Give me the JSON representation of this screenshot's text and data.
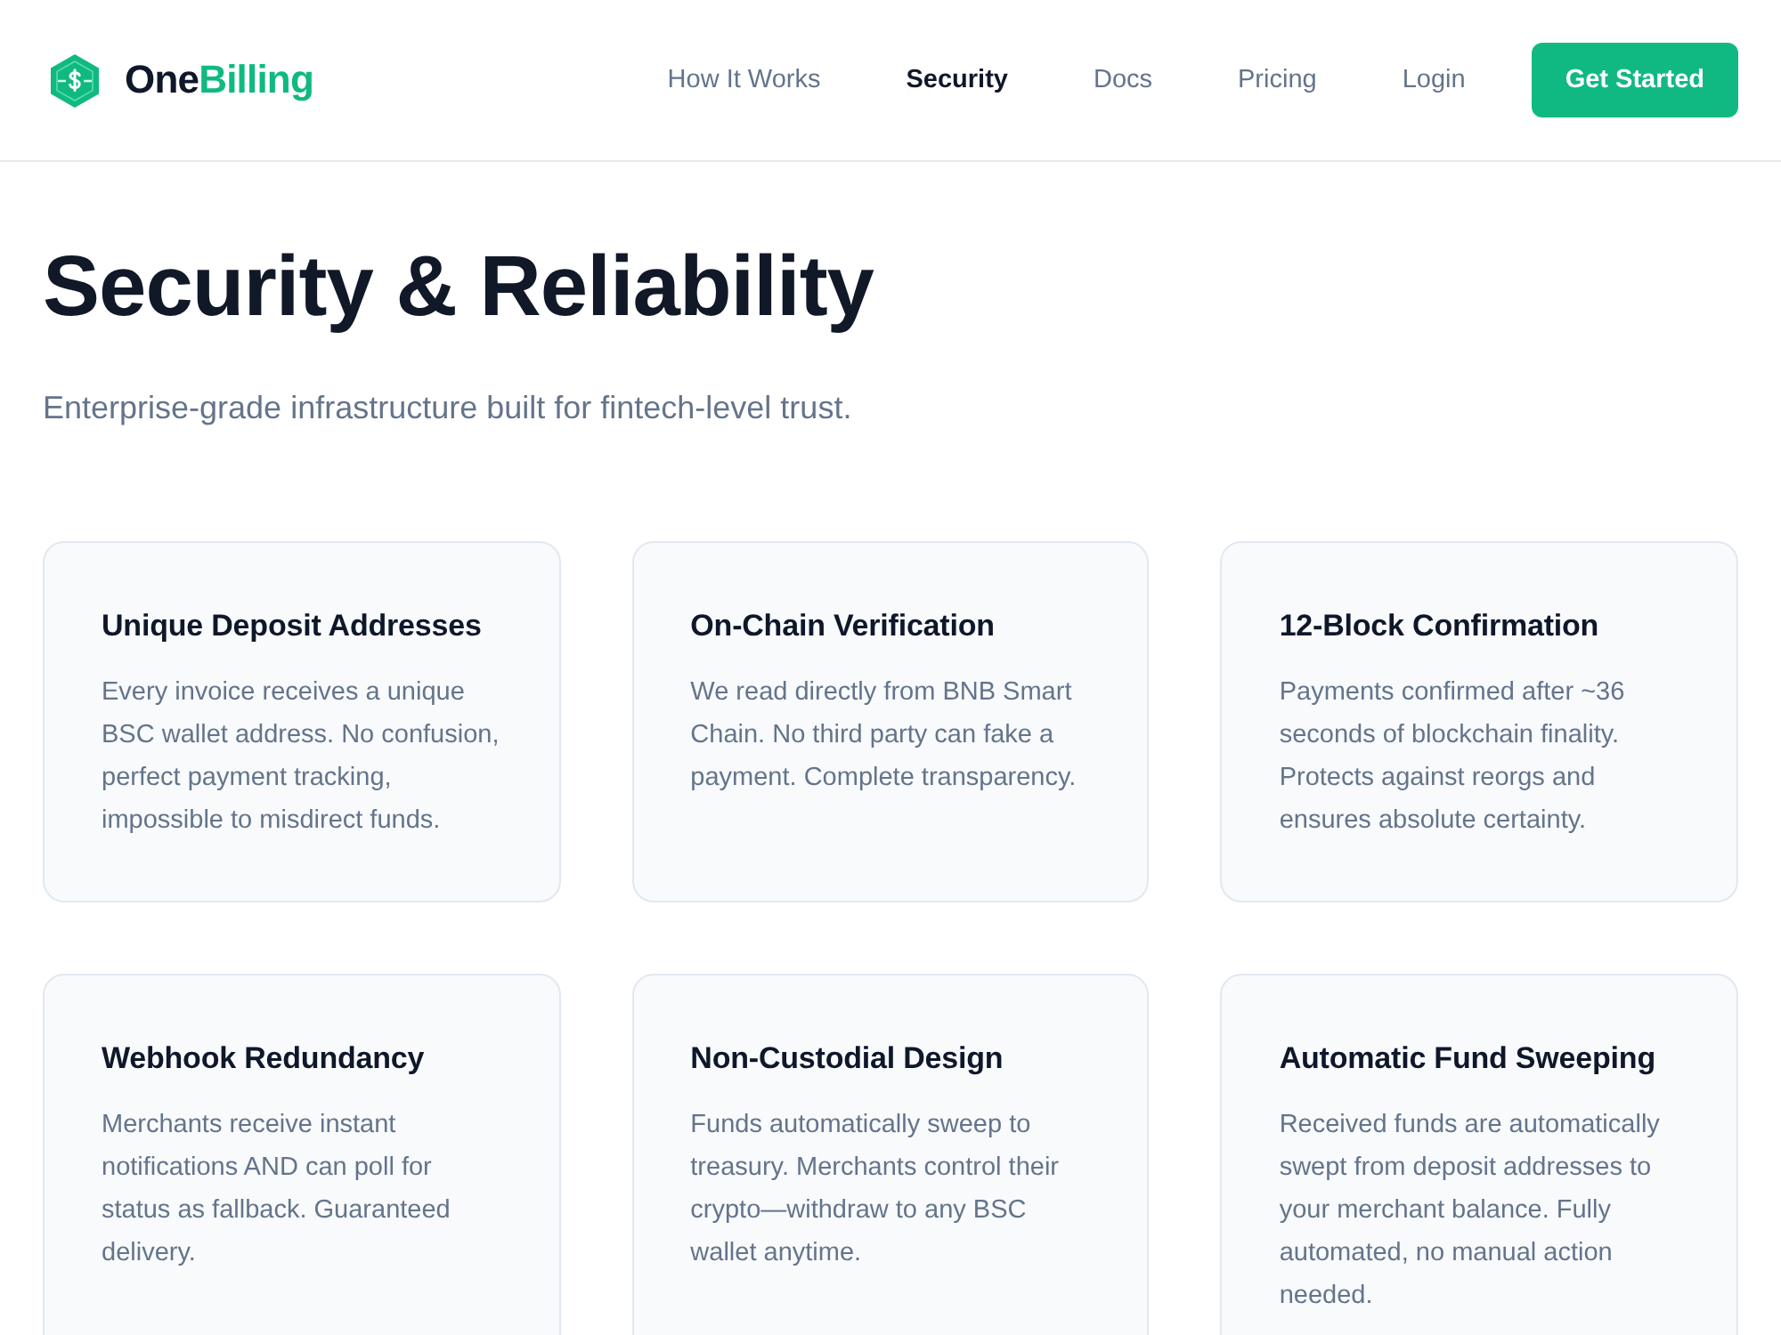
{
  "header": {
    "brand": {
      "parts": [
        {
          "text": "One",
          "accent": false
        },
        {
          "text": "Billing",
          "accent": true
        }
      ]
    },
    "nav": [
      {
        "label": "How It Works",
        "selected": false
      },
      {
        "label": "Security",
        "selected": true
      },
      {
        "label": "Docs",
        "selected": false
      },
      {
        "label": "Pricing",
        "selected": false
      },
      {
        "label": "Login",
        "selected": false
      }
    ],
    "cta": "Get Started"
  },
  "hero": {
    "title": "Security & Reliability",
    "subtitle": "Enterprise-grade infrastructure built for fintech-level trust."
  },
  "features": [
    {
      "title": "Unique Deposit Addresses",
      "text": "Every invoice receives a unique BSC wallet address. No confusion, perfect payment tracking, impossible to misdirect funds."
    },
    {
      "title": "On-Chain Verification",
      "text": "We read directly from BNB Smart Chain. No third party can fake a payment. Complete transparency."
    },
    {
      "title": "12-Block Confirmation",
      "text": "Payments confirmed after ~36 seconds of blockchain finality. Protects against reorgs and ensures absolute certainty."
    },
    {
      "title": "Webhook Redundancy",
      "text": "Merchants receive instant notifications AND can poll for status as fallback. Guaranteed delivery."
    },
    {
      "title": "Non-Custodial Design",
      "text": "Funds automatically sweep to treasury. Merchants control their crypto—withdraw to any BSC wallet anytime."
    },
    {
      "title": "Automatic Fund Sweeping",
      "text": "Received funds are automatically swept from deposit addresses to your merchant balance. Fully automated, no manual action needed."
    }
  ]
}
